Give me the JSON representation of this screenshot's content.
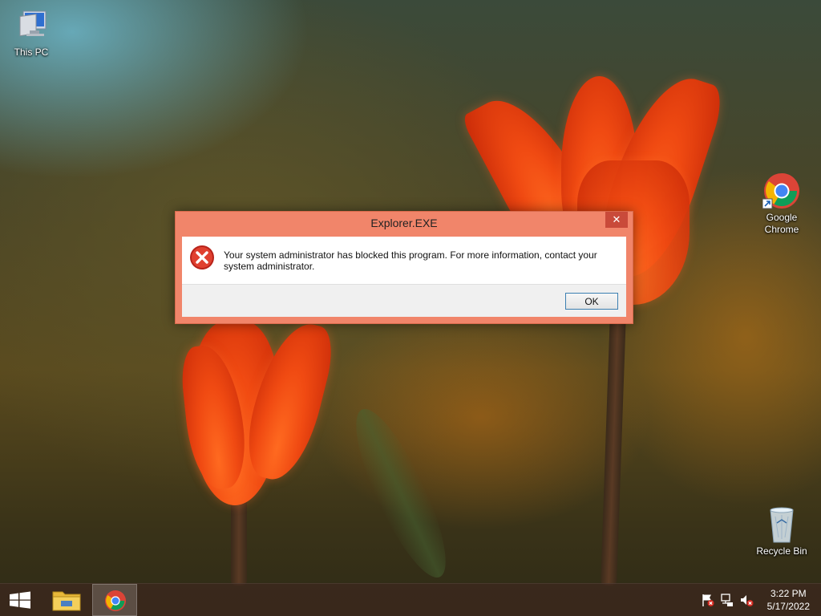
{
  "desktop": {
    "icons": [
      {
        "label": "This PC",
        "icon": "this-pc-icon"
      },
      {
        "label": "Google Chrome",
        "icon": "chrome-icon"
      },
      {
        "label": "Recycle Bin",
        "icon": "recycle-bin-icon"
      }
    ]
  },
  "dialog": {
    "title": "Explorer.EXE",
    "close_glyph": "✕",
    "message": "Your system administrator has blocked this program. For more information, contact your system administrator.",
    "ok_label": "OK",
    "icon": "error-icon"
  },
  "taskbar": {
    "start_icon": "windows-start-icon",
    "pinned": [
      {
        "name": "file-explorer",
        "icon": "folder-icon",
        "active": false
      },
      {
        "name": "chrome",
        "icon": "chrome-icon",
        "active": true
      }
    ],
    "tray": [
      {
        "icon": "action-center-flag-icon"
      },
      {
        "icon": "network-icon"
      },
      {
        "icon": "volume-muted-icon"
      }
    ],
    "clock": {
      "time": "3:22 PM",
      "date": "5/17/2022"
    }
  },
  "colors": {
    "dialog_frame": "#f1856a",
    "close_button": "#c94a3a",
    "error_red": "#d42a20",
    "taskbar": "#3c281e"
  }
}
